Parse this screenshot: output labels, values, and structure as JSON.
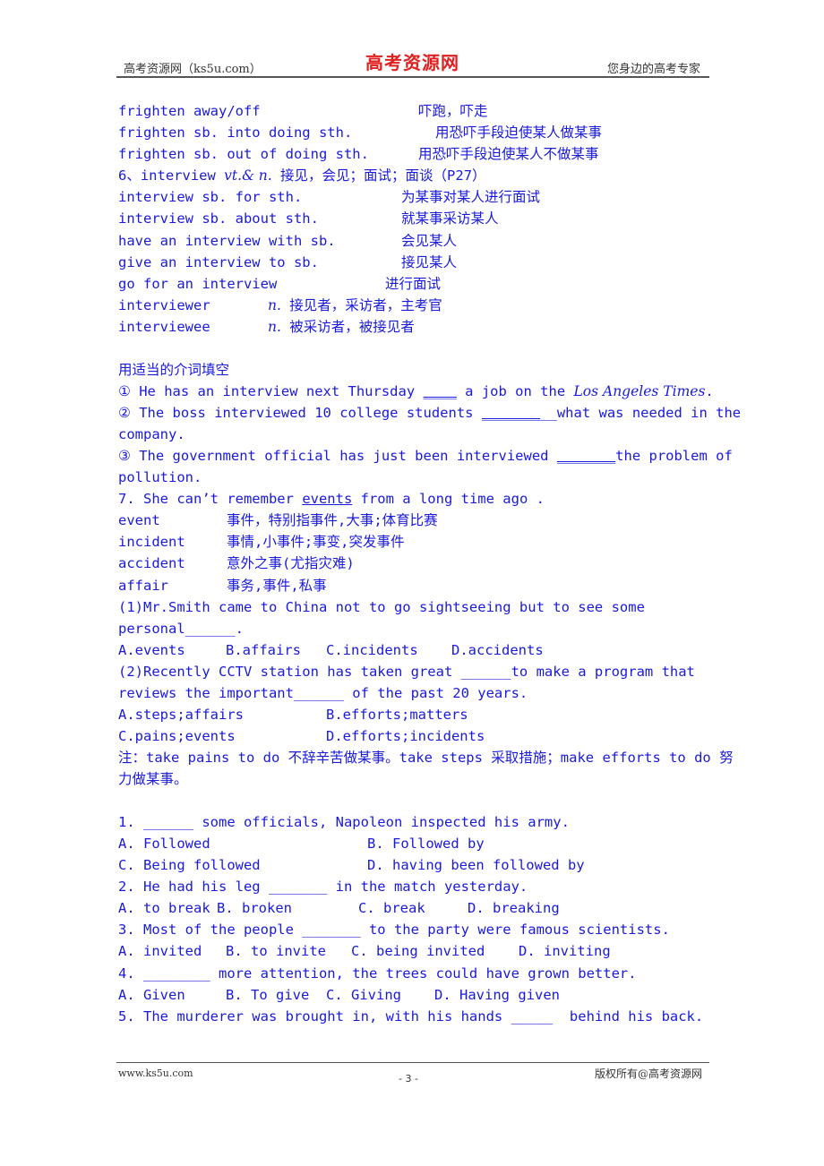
{
  "header": {
    "left": "高考资源网（ks5u.com）",
    "logo": "高考资源网",
    "right": "您身边的高考专家"
  },
  "vocab_frighten": [
    {
      "en": "frighten away/off",
      "zh": "吓跑，吓走"
    },
    {
      "en": "frighten sb. into doing sth.",
      "zh": "用恐吓手段迫使某人做某事"
    },
    {
      "en": "frighten sb. out of doing sth.",
      "zh": "用恐吓手段迫使某人不做某事"
    }
  ],
  "interview": {
    "heading_num": "6、interview ",
    "heading_pos": "vt.& n.",
    "heading_def": " 接见，会见；面试；面谈（P27）",
    "phrases": [
      {
        "en": "interview sb. for sth.",
        "zh": "为某事对某人进行面试"
      },
      {
        "en": "interview sb. about sth.",
        "zh": "就某事采访某人"
      },
      {
        "en": "have an interview with sb.",
        "zh": "会见某人"
      },
      {
        "en": "give an interview to sb.",
        "zh": "接见某人"
      },
      {
        "en": "go for an interview",
        "zh": "进行面试"
      }
    ],
    "derivs": [
      {
        "en": "interviewer",
        "pos": "n.",
        "zh": " 接见者，采访者，主考官"
      },
      {
        "en": "interviewee",
        "pos": "n.",
        "zh": " 被采访者，被接见者"
      }
    ]
  },
  "fill_prep": {
    "title": "用适当的介词填空",
    "q1_a": "① He has an interview next Thursday ",
    "q1_blank": "____",
    "q1_b": " a job on the ",
    "q1_italic": "Los Angeles Times",
    "q1_end": ".",
    "q2_a": "② The boss interviewed 10 college students ",
    "q2_blank": "_______",
    "q2_b": "__what was needed in the company.",
    "q3_a": "③ The government official has just been interviewed ",
    "q3_blank": "_______",
    "q3_b": "the problem of pollution."
  },
  "events": {
    "heading_a": "7. She can’t remember ",
    "heading_u": "events",
    "heading_b": " from a long time ago .",
    "words": [
      {
        "en": "event",
        "zh": "事件，特别指事件,大事;体育比赛"
      },
      {
        "en": "incident",
        "zh": "事情,小事件;事变,突发事件"
      },
      {
        "en": "accident",
        "zh": "意外之事(尤指灾难)"
      },
      {
        "en": "affair",
        "zh": "事务,事件,私事"
      }
    ],
    "ex1_q": "(1)Mr.Smith came to China not to go sightseeing but to see some personal______.",
    "ex1_opts": [
      "A.events",
      "B.affairs",
      "C.incidents",
      "D.accidents"
    ],
    "ex2_q": "(2)Recently CCTV station has taken great ______to make a program that reviews the important______ of the past 20 years.",
    "ex2_opts": [
      "A.steps;affairs",
      "B.efforts;matters",
      "C.pains;events",
      "D.efforts;incidents"
    ],
    "note": "注：take pains to do 不辞辛苦做某事。take steps 采取措施；make efforts to do 努力做某事。"
  },
  "questions": [
    {
      "q": "1. ______ some officials, Napoleon inspected his army.",
      "opts": [
        "A. Followed",
        "B. Followed by",
        "C. Being followed",
        "D. having been followed by"
      ]
    },
    {
      "q": "2. He had his leg _______ in the match yesterday.",
      "opts": [
        "A. to break",
        "B. broken",
        "C. break",
        "D. breaking"
      ]
    },
    {
      "q": "3. Most of the people _______ to the party were famous scientists.",
      "opts": [
        "A. invited",
        "B. to invite",
        "C. being invited",
        "D. inviting"
      ]
    },
    {
      "q": "4. ________ more attention, the trees could have grown better.",
      "opts": [
        "A. Given",
        "B. To give",
        "C. Giving",
        "D. Having given"
      ]
    },
    {
      "q": "5. The murderer was brought in, with his hands _____  behind his back."
    }
  ],
  "footer": {
    "left": "www.ks5u.com",
    "page": "- 3 -",
    "right": "版权所有@高考资源网"
  }
}
